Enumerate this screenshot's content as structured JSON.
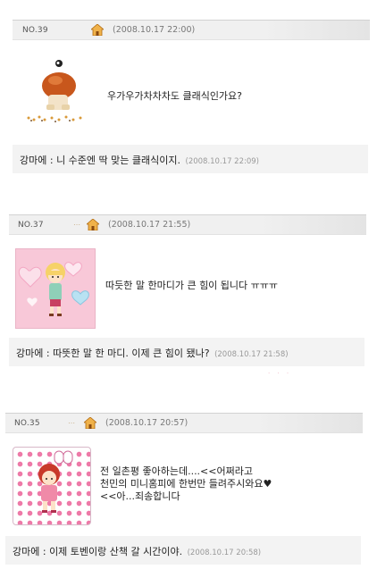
{
  "entries": [
    {
      "no": "NO.39",
      "date": "(2008.10.17 22:00)",
      "post_text": "우가우가차차차도 클래식인가요?",
      "reply_prefix": "강마에 : ",
      "reply_text": "니 수준엔 딱 맞는 클래식이지.",
      "reply_date": "(2008.10.17 22:09)"
    },
    {
      "no": "NO.37",
      "date": "(2008.10.17 21:55)",
      "post_text": "따듯한 말 한마디가 큰 힘이 됩니다 ㅠㅠㅠ",
      "reply_prefix": "강마에 : ",
      "reply_text": "따뜻한 말 한 마디. 이제 큰 힘이 됐나?",
      "reply_date": "(2008.10.17 21:58)"
    },
    {
      "no": "NO.35",
      "date": "(2008.10.17 20:57)",
      "post_lines": [
        "전 일촌평 좋아하는데....<<어쩌라고",
        "천민의 미니홈피에 한번만 들려주시와요♥",
        "<<아...죄송합니다"
      ],
      "reply_prefix": "강마에 : ",
      "reply_text": "이제 토벤이랑 산책 갈 시간이야.",
      "reply_date": "(2008.10.17 20:58)"
    }
  ],
  "icons": {
    "home": "home-icon",
    "avatar_1": "mushroom-avatar-icon",
    "avatar_2": "girl-hearts-avatar-icon",
    "avatar_3": "girl-dots-avatar-icon"
  },
  "colors": {
    "header_bg": "#f0f0f0",
    "reply_bg": "#f3f3f3",
    "home_icon": "#e8a23a",
    "heart_pink": "#f5a9c8",
    "dot_pink": "#ee7aa8"
  }
}
